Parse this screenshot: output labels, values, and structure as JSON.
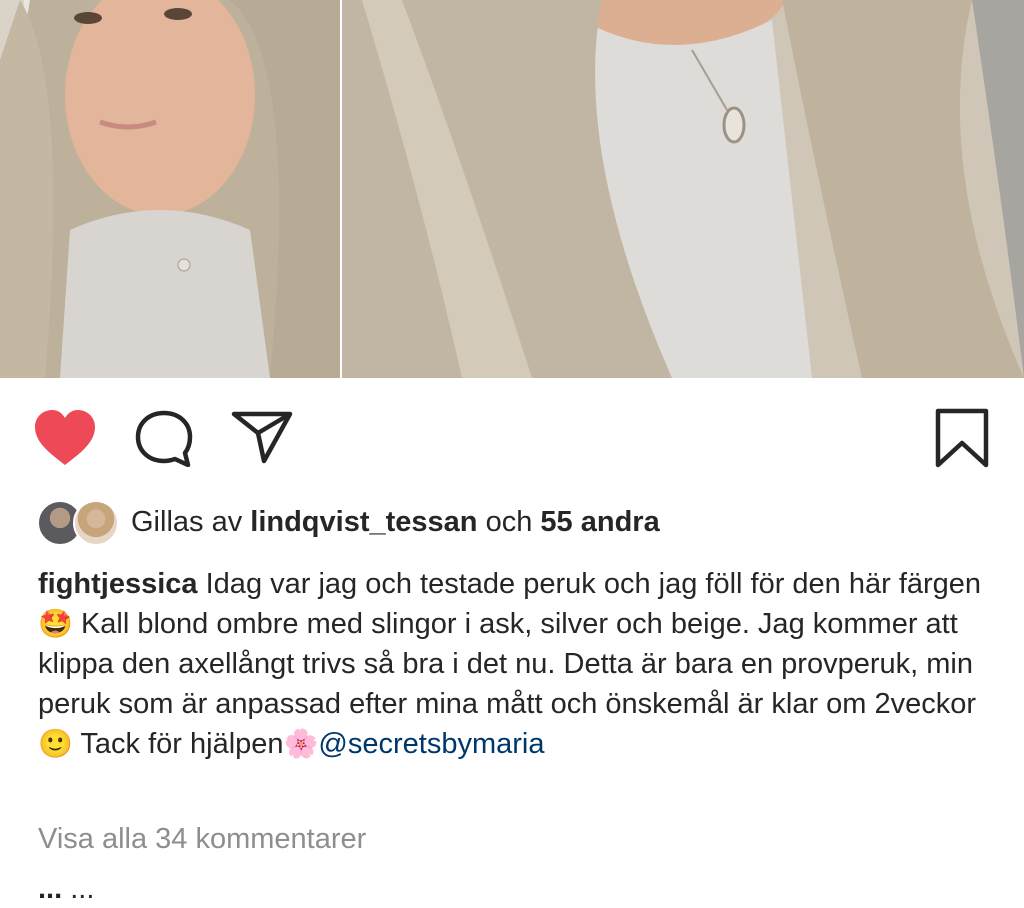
{
  "post": {
    "photos": [
      "left-selfie",
      "right-closeup"
    ],
    "actions": {
      "like_icon": "heart-filled-icon",
      "comment_icon": "comment-bubble-icon",
      "share_icon": "paper-plane-icon",
      "save_icon": "bookmark-icon",
      "like_color": "#ed4956"
    },
    "likes": {
      "prefix": "Gillas av",
      "user": "lindqvist_tessan",
      "joiner": "och",
      "others": "55 andra"
    },
    "caption": {
      "username": "fightjessica",
      "text_1": "Idag var jag och testade peruk och jag föll för den här färgen",
      "emoji_1": "🤩",
      "text_2": "Kall blond ombre med slingor i ask, silver och beige. Jag kommer att klippa den axellångt trivs så bra i det nu. Detta är bara en provperuk, min peruk som är anpassad efter mina mått och önskemål är klar om 2veckor",
      "emoji_2": "🙂",
      "text_3": "Tack för hjälpen",
      "emoji_3": "🌸",
      "mention": "@secretsbymaria"
    },
    "view_comments": "Visa alla 34 kommentarer",
    "next_comment": {
      "username": "...",
      "text": "..."
    }
  }
}
